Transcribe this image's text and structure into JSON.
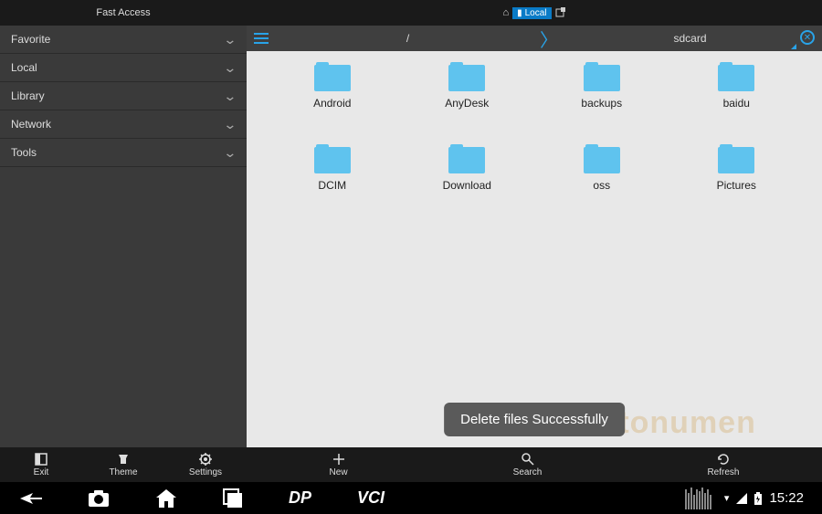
{
  "statusbar": {
    "title": "Fast Access",
    "location": "Local"
  },
  "sidebar": {
    "items": [
      {
        "label": "Favorite"
      },
      {
        "label": "Local"
      },
      {
        "label": "Library"
      },
      {
        "label": "Network"
      },
      {
        "label": "Tools"
      }
    ],
    "bottom": {
      "exit": "Exit",
      "theme": "Theme",
      "settings": "Settings"
    }
  },
  "pathbar": {
    "root": "/",
    "current": "sdcard"
  },
  "folders": [
    {
      "name": "Android"
    },
    {
      "name": "AnyDesk"
    },
    {
      "name": "backups"
    },
    {
      "name": "baidu"
    },
    {
      "name": "DCIM"
    },
    {
      "name": "Download"
    },
    {
      "name": "oss"
    },
    {
      "name": "Pictures"
    }
  ],
  "toast": "Delete files Successfully",
  "content_bottom": {
    "new": "New",
    "search": "Search",
    "refresh": "Refresh"
  },
  "navbar": {
    "dp": "DP",
    "vci": "VCI",
    "time": "15:22"
  }
}
